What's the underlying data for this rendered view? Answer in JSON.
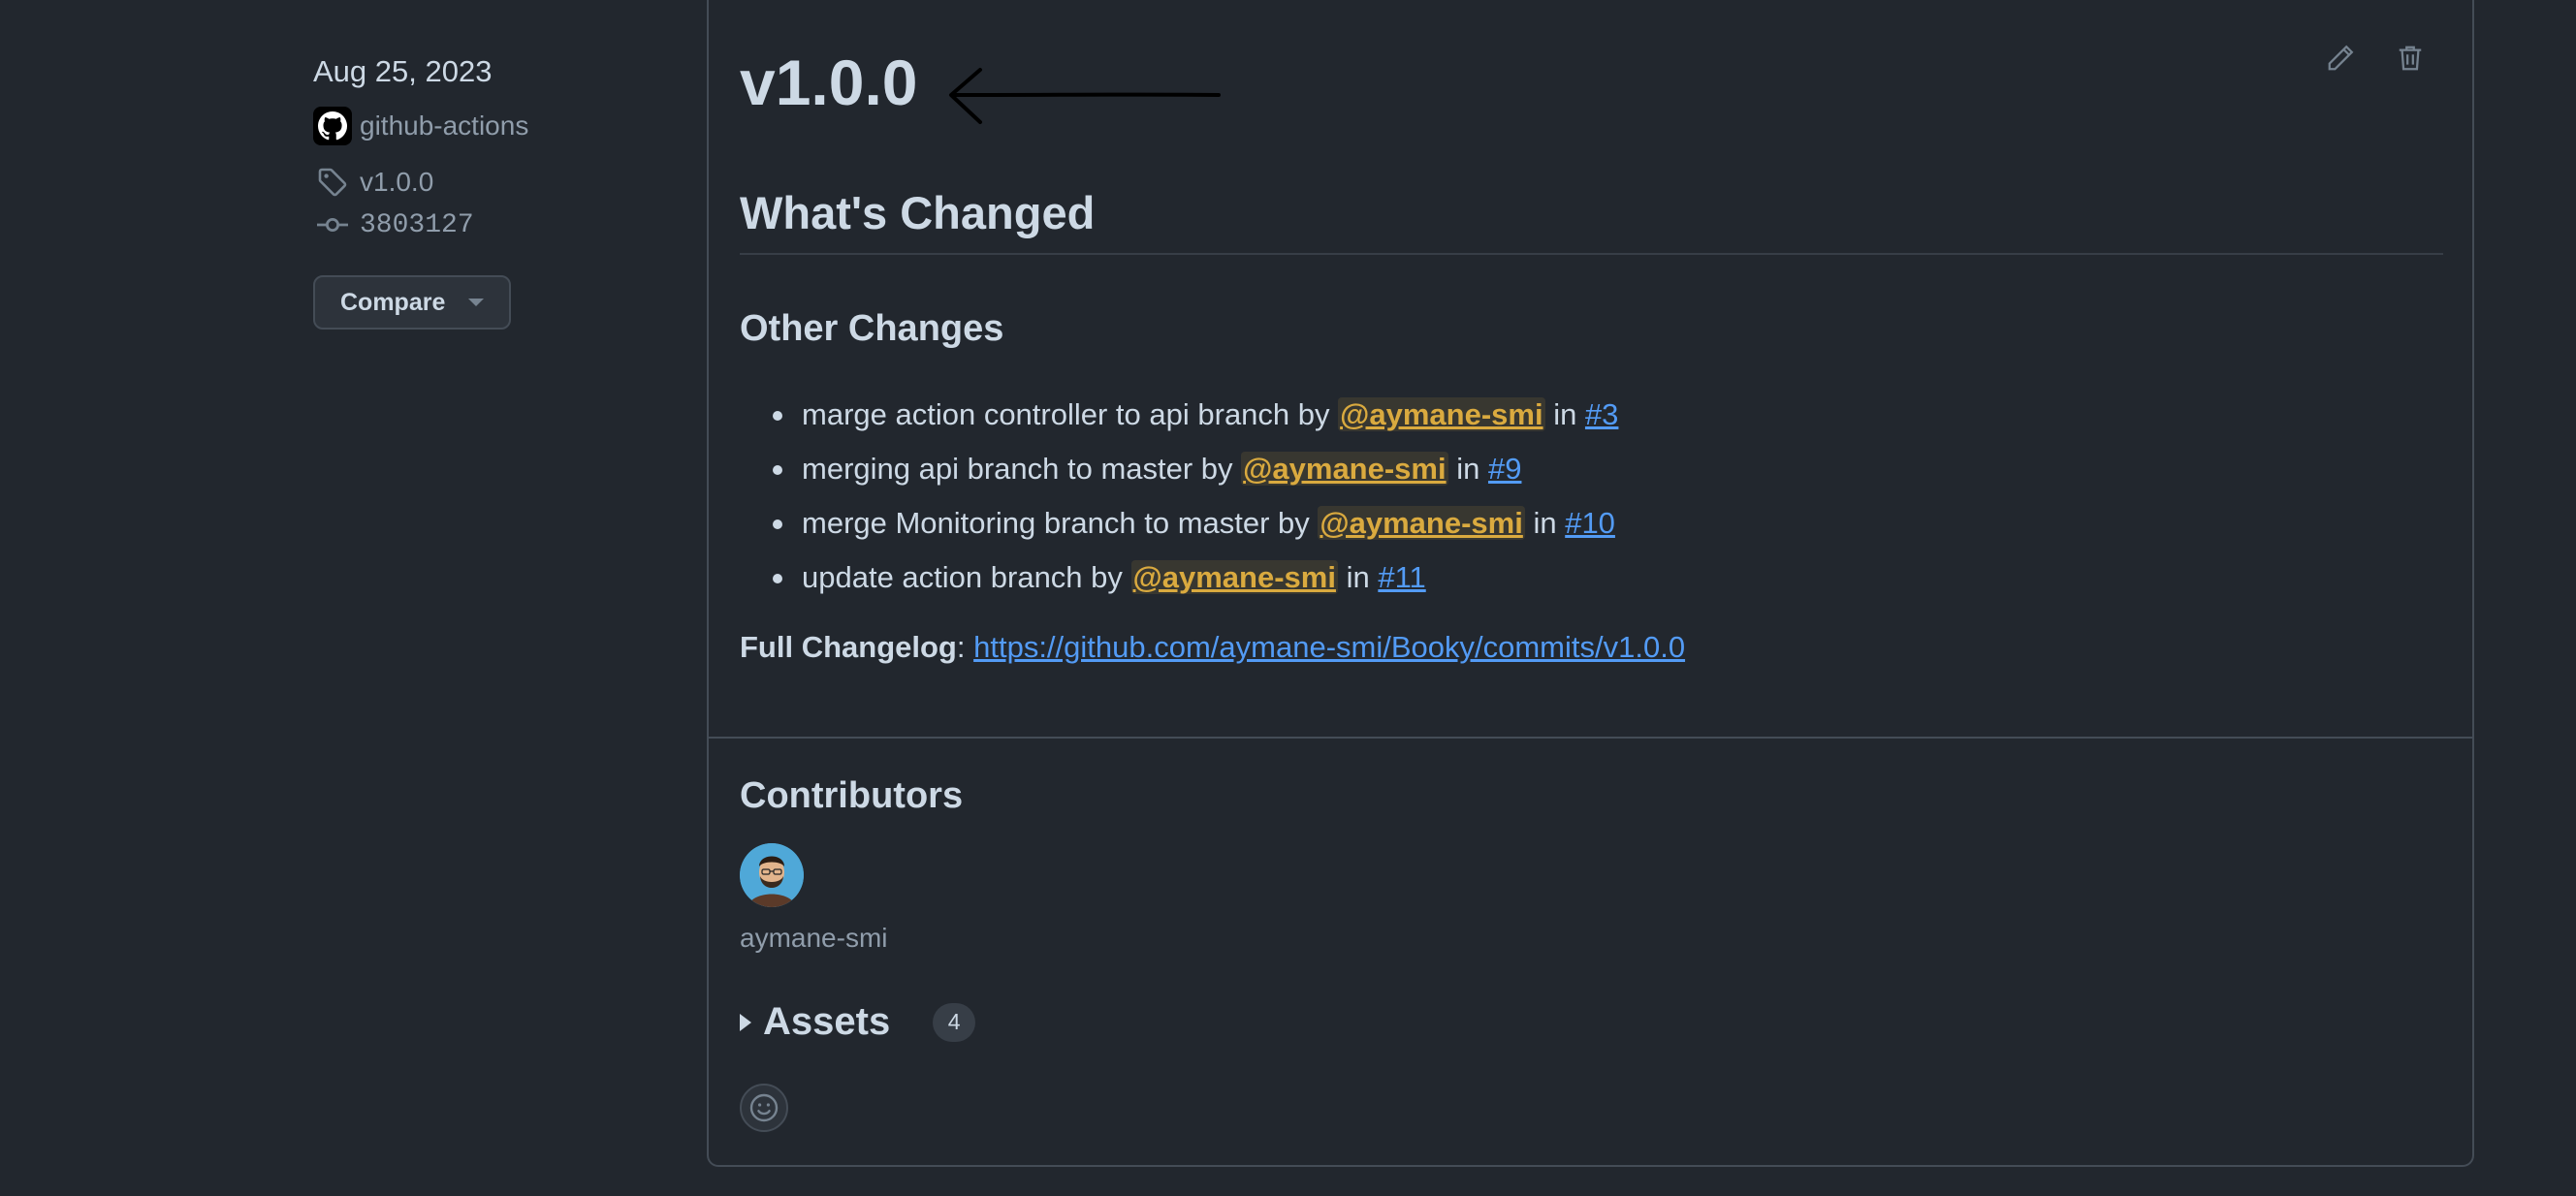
{
  "meta": {
    "date": "Aug 25, 2023",
    "author": "github-actions",
    "tag": "v1.0.0",
    "commit": "3803127",
    "compare_label": "Compare"
  },
  "release": {
    "title": "v1.0.0",
    "whats_changed": "What's Changed",
    "other_changes": "Other Changes",
    "changes": [
      {
        "text": "marge action controller to api branch by ",
        "mention": "@aymane-smi",
        "in": " in ",
        "issue": "#3"
      },
      {
        "text": "merging api branch to master by ",
        "mention": "@aymane-smi",
        "in": " in ",
        "issue": "#9"
      },
      {
        "text": "merge Monitoring branch to master by ",
        "mention": "@aymane-smi",
        "in": " in ",
        "issue": "#10"
      },
      {
        "text": "update action branch by ",
        "mention": "@aymane-smi",
        "in": " in ",
        "issue": "#11"
      }
    ],
    "full_changelog_label": "Full Changelog",
    "full_changelog_sep": ": ",
    "full_changelog_url": "https://github.com/aymane-smi/Booky/commits/v1.0.0"
  },
  "contributors": {
    "heading": "Contributors",
    "items": [
      {
        "name": "aymane-smi"
      }
    ]
  },
  "assets": {
    "label": "Assets",
    "count": "4"
  },
  "colors": {
    "background": "#22272e",
    "border": "#444c56",
    "link": "#539bf5",
    "mention": "#daaa3f"
  }
}
